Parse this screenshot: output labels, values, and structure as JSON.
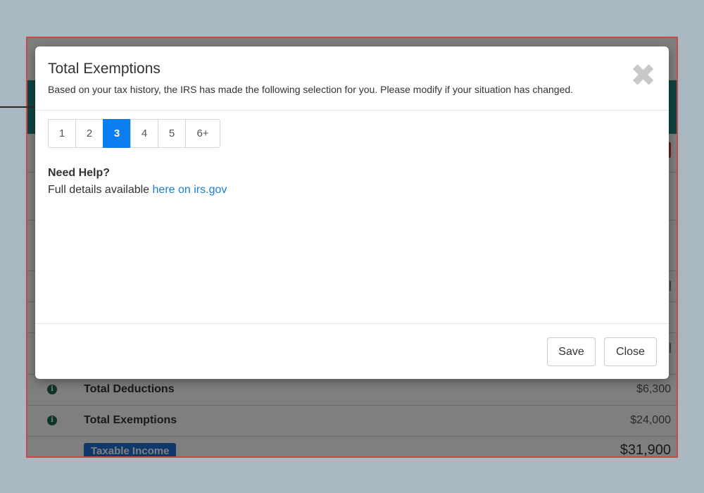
{
  "background_page": {
    "rows": [
      {
        "label": "Total Deductions",
        "value": "$6,300"
      },
      {
        "label": "Total Exemptions",
        "value": "$24,000"
      }
    ],
    "taxable": {
      "label": "Taxable Income",
      "value": "$31,900"
    },
    "info_icon_glyph": "i",
    "colors": {
      "teal_band": "#1f8a84",
      "frame_border": "#c94a4a",
      "badge": "#1e73d4"
    }
  },
  "modal": {
    "title": "Total Exemptions",
    "subtitle": "Based on your tax history, the IRS has made the following selection for you. Please modify if your situation has changed.",
    "close_icon": "✖",
    "pager": {
      "options": [
        "1",
        "2",
        "3",
        "4",
        "5",
        "6+"
      ],
      "selected": "3"
    },
    "help": {
      "title": "Need Help?",
      "text": "Full details available ",
      "link_text": "here on irs.gov"
    },
    "footer": {
      "save_label": "Save",
      "close_label": "Close"
    },
    "colors": {
      "accent": "#0a7ef0",
      "link": "#1a7fd6"
    }
  }
}
